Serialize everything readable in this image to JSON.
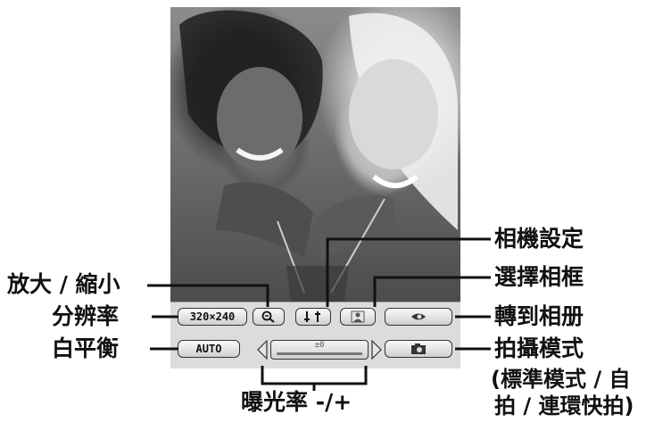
{
  "screen": {
    "background": "#ffffff",
    "accent": "#111111"
  },
  "toolbar": {
    "resolution_value": "320×240",
    "white_balance_value": "AUTO",
    "exposure_value": "±0",
    "buttons": {
      "zoom": "zoom-magnifier-icon",
      "settings": "camera-settings-icon",
      "frame": "person-frame-icon",
      "album": "eye-album-icon",
      "mode": "camera-mode-icon"
    }
  },
  "callouts": {
    "zoom": "放大 / 縮小",
    "resolution": "分辨率",
    "white_balance": "白平衡",
    "exposure": "曝光率 -/+",
    "camera_settings": "相機設定",
    "select_frame": "選擇相框",
    "go_to_album": "轉到相册",
    "shooting_mode": "拍攝模式",
    "shooting_mode_detail_1": "(標準模式 / 自",
    "shooting_mode_detail_2": "拍 / 連環快拍)"
  }
}
